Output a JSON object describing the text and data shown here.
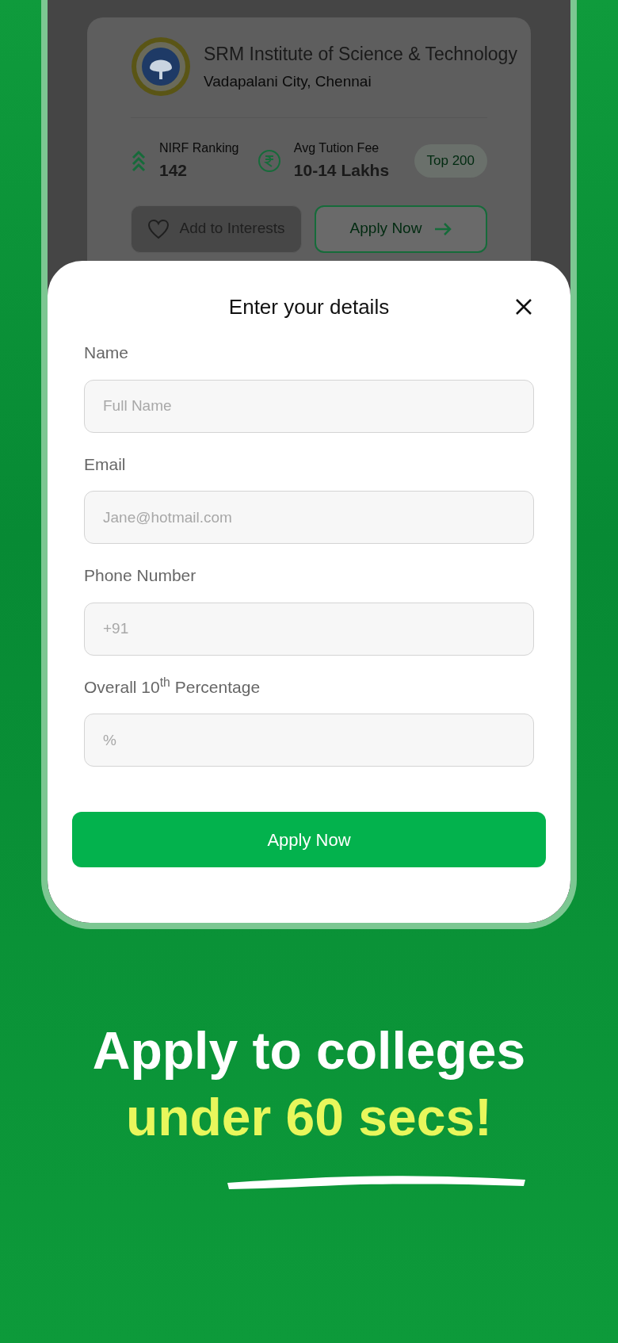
{
  "college_card": {
    "name": "SRM Institute of Science & Technology",
    "location": "Vadapalani City, Chennai",
    "stats": [
      {
        "kind": "ranking",
        "label": "NIRF Ranking",
        "value": "142"
      },
      {
        "kind": "fee",
        "label": "Avg Tution Fee",
        "value": "10-14 Lakhs"
      }
    ],
    "badge": "Top 200",
    "buttons": [
      {
        "kind": "interest",
        "label": "Add to Interests"
      },
      {
        "kind": "apply",
        "label": "Apply Now"
      }
    ]
  },
  "modal": {
    "title": "Enter your details",
    "fields": [
      {
        "label": "Name",
        "placeholder": "Full Name"
      },
      {
        "label": "Email",
        "placeholder": "Jane@hotmail.com"
      },
      {
        "label": "Phone Number",
        "placeholder": "+91"
      },
      {
        "label": "Overall 10$^{th}$ Percentage",
        "placeholder": "%"
      }
    ],
    "submit": "Apply Now"
  },
  "headline": {
    "line_1": "Apply to colleges",
    "line_2": "under 60 secs!"
  }
}
